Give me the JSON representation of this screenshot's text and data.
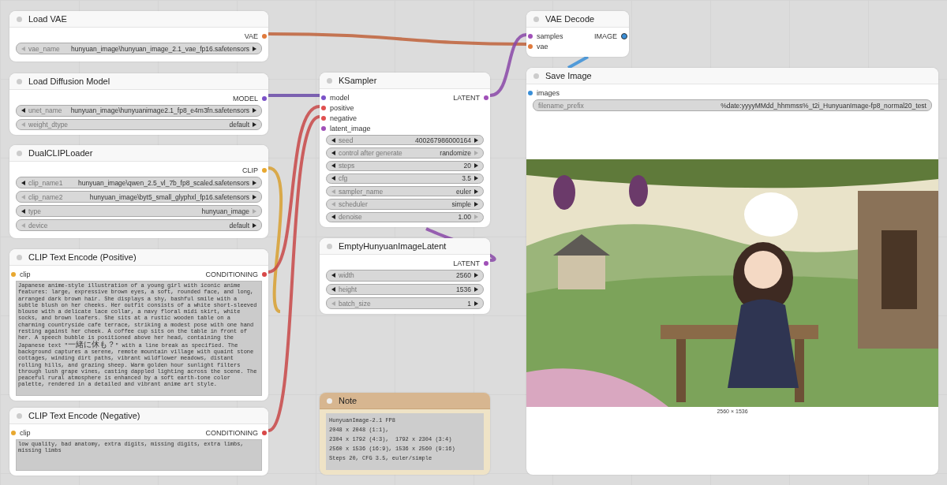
{
  "nodes": [
    {
      "kind": "node",
      "title": "Load VAE",
      "outputs": [
        {
          "label": "VAE",
          "color": "#e07a3c"
        }
      ],
      "widgets": [
        {
          "name": "vae_name",
          "value": "hunyuan_image\\hunyuan_image_2.1_vae_fp16.safetensors",
          "prev": false,
          "next": true
        }
      ]
    },
    {
      "kind": "node",
      "title": "Load Diffusion Model",
      "outputs": [
        {
          "label": "MODEL",
          "color": "#7b52c8"
        }
      ],
      "widgets": [
        {
          "name": "unet_name",
          "value": "hunyuan_image\\hunyuanimage2.1_fp8_e4m3fn.safetensors",
          "prev": true,
          "next": true
        },
        {
          "name": "weight_dtype",
          "value": "default",
          "prev": false,
          "next": true
        }
      ]
    },
    {
      "kind": "node",
      "title": "DualCLIPLoader",
      "outputs": [
        {
          "label": "CLIP",
          "color": "#e8a830"
        }
      ],
      "widgets": [
        {
          "name": "clip_name1",
          "value": "hunyuan_image\\qwen_2.5_vl_7b_fp8_scaled.safetensors",
          "prev": true,
          "next": true
        },
        {
          "name": "clip_name2",
          "value": "hunyuan_image\\byt5_small_glyphxl_fp16.safetensors",
          "prev": false,
          "next": true
        },
        {
          "name": "type",
          "value": "hunyuan_image",
          "prev": true,
          "next": false
        },
        {
          "name": "device",
          "value": "default",
          "prev": false,
          "next": true
        }
      ]
    },
    {
      "kind": "node",
      "title": "CLIP Text Encode (Positive)",
      "inputs": [
        {
          "label": "clip",
          "color": "#e8a830"
        }
      ],
      "outputs": [
        {
          "label": "CONDITIONING",
          "color": "#d84848"
        }
      ],
      "text": "Japanese anime-style illustration of a young girl with iconic anime features: large, expressive brown eyes, a soft, rounded face, and long, arranged dark brown hair. She displays a shy, bashful smile with a subtle blush on her cheeks. Her outfit consists of a white short-sleeved blouse with a delicate lace collar, a navy floral midi skirt, white socks, and brown loafers. She sits at a rustic wooden table on a charming countryside cafe terrace, striking a modest pose with one hand resting against her cheek. A coffee cup sits on the table in front of her. A speech bubble is positioned above her head, containing the Japanese text \"一緒に休も？\" with a line break as specified. The background captures a serene, remote mountain village with quaint stone cottages, winding dirt paths, vibrant wildflower meadows, distant rolling hills, and grazing sheep. Warm golden hour sunlight filters through lush grape vines, casting dappled lighting across the scene. The peaceful rural atmosphere is enhanced by a soft earth-tone color palette, rendered in a detailed and vibrant anime art style."
    },
    {
      "kind": "node",
      "title": "CLIP Text Encode (Negative)",
      "inputs": [
        {
          "label": "clip",
          "color": "#e8a830"
        }
      ],
      "outputs": [
        {
          "label": "CONDITIONING",
          "color": "#d84848"
        }
      ],
      "text": "low quality, bad anatomy, extra digits, missing digits, extra limbs, missing limbs"
    },
    {
      "kind": "node",
      "title": "KSampler",
      "inputs": [
        {
          "label": "model",
          "color": "#7b52c8"
        },
        {
          "label": "positive",
          "color": "#e05050"
        },
        {
          "label": "negative",
          "color": "#e05050"
        },
        {
          "label": "latent_image",
          "color": "#a050b8"
        }
      ],
      "outputs": [
        {
          "label": "LATENT",
          "color": "#a050b8"
        }
      ],
      "widgets": [
        {
          "name": "seed",
          "value": "400267986000164",
          "prev": true,
          "next": true
        },
        {
          "name": "control after generate",
          "value": "randomize",
          "prev": true,
          "next": false
        },
        {
          "name": "steps",
          "value": "20",
          "prev": true,
          "next": true
        },
        {
          "name": "cfg",
          "value": "3.5",
          "prev": true,
          "next": true
        },
        {
          "name": "sampler_name",
          "value": "euler",
          "prev": false,
          "next": true
        },
        {
          "name": "scheduler",
          "value": "simple",
          "prev": false,
          "next": true
        },
        {
          "name": "denoise",
          "value": "1.00",
          "prev": true,
          "next": false
        }
      ]
    },
    {
      "kind": "node",
      "title": "EmptyHunyuanImageLatent",
      "outputs": [
        {
          "label": "LATENT",
          "color": "#a050b8"
        }
      ],
      "widgets": [
        {
          "name": "width",
          "value": "2560",
          "prev": true,
          "next": true
        },
        {
          "name": "height",
          "value": "1536",
          "prev": true,
          "next": true
        },
        {
          "name": "batch_size",
          "value": "1",
          "prev": false,
          "next": true
        }
      ]
    },
    {
      "kind": "note",
      "title": "Note",
      "lines": [
        "HunyuanImage-2.1 FP8",
        "2048 x 2048 (1:1),",
        "2304 x 1792 (4:3),  1792 x 2304 (3:4)",
        "2560 x 1536 (16:9), 1536 x 2560 (9:16)",
        "Steps 20, CFG 3.5, euler/simple"
      ]
    },
    {
      "kind": "node",
      "title": "VAE Decode",
      "inputs": [
        {
          "label": "samples",
          "color": "#a050b8"
        },
        {
          "label": "vae",
          "color": "#e07a3c"
        }
      ],
      "outputs": [
        {
          "label": "IMAGE",
          "color": "#3a8fd8"
        }
      ]
    },
    {
      "kind": "node",
      "title": "Save Image",
      "inputs": [
        {
          "label": "images",
          "color": "#3a8fd8"
        }
      ],
      "widgets": [
        {
          "name": "filename_prefix",
          "value": "%date:yyyyMMdd_hhmmss%_t2i_HunyuanImage-fp8_normal20_test"
        }
      ],
      "image": {
        "kind": "picture",
        "caption": "2560 × 1536"
      }
    }
  ]
}
